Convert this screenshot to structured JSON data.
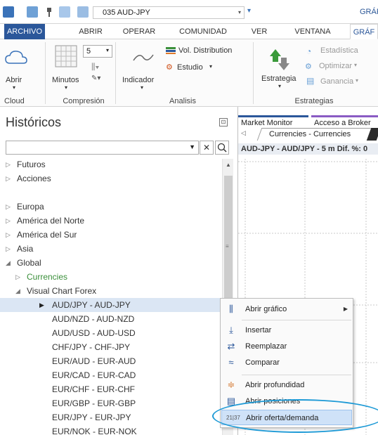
{
  "titlebar": {
    "document": "035 AUD-JPY",
    "right_tab": "GRÁF"
  },
  "tabs": [
    "ARCHIVO",
    "ABRIR",
    "OPERAR",
    "COMUNIDAD",
    "VER",
    "VENTANA",
    "GRÁF"
  ],
  "ribbon": {
    "abrir": "Abrir",
    "minutos": "Minutos",
    "compression_value": "5",
    "indicador": "Indicador",
    "vol_distribution": "Vol. Distribution",
    "estudio": "Estudio",
    "estrategia": "Estrategia",
    "estadistica": "Estadística",
    "optimizar": "Optimizar",
    "ganancia": "Ganancia",
    "groups": [
      "Cloud",
      "Compresión",
      "Analisis",
      "Estrategias"
    ]
  },
  "left_panel": {
    "title": "Históricos",
    "search_value": "",
    "tree": [
      {
        "label": "Futuros",
        "level": 0,
        "toggle": "▷"
      },
      {
        "label": "Acciones",
        "level": 0,
        "toggle": "▷"
      },
      {
        "label": "Europa",
        "level": 0,
        "toggle": "▷"
      },
      {
        "label": "América del Norte",
        "level": 0,
        "toggle": "▷"
      },
      {
        "label": "América del Sur",
        "level": 0,
        "toggle": "▷"
      },
      {
        "label": "Asia",
        "level": 0,
        "toggle": "▷"
      },
      {
        "label": "Global",
        "level": 0,
        "toggle": "◢"
      },
      {
        "label": "Currencies",
        "level": 1,
        "toggle": "▷",
        "color": "#3a8f3a"
      },
      {
        "label": "Visual Chart Forex",
        "level": 1,
        "toggle": "◢"
      },
      {
        "label": "AUD/JPY - AUD-JPY",
        "level": 2,
        "toggle": "▶",
        "selected": true
      },
      {
        "label": "AUD/NZD - AUD-NZD",
        "level": 2
      },
      {
        "label": "AUD/USD - AUD-USD",
        "level": 2
      },
      {
        "label": "CHF/JPY - CHF-JPY",
        "level": 2
      },
      {
        "label": "EUR/AUD - EUR-AUD",
        "level": 2
      },
      {
        "label": "EUR/CAD - EUR-CAD",
        "level": 2
      },
      {
        "label": "EUR/CHF - EUR-CHF",
        "level": 2
      },
      {
        "label": "EUR/GBP - EUR-GBP",
        "level": 2
      },
      {
        "label": "EUR/JPY - EUR-JPY",
        "level": 2
      },
      {
        "label": "EUR/NOK - EUR-NOK",
        "level": 2
      }
    ]
  },
  "right_panel": {
    "tab_market_monitor": "Market Monitor",
    "tab_acceso": "Acceso a Broker",
    "subtab": "Currencies - Currencies",
    "chart_header": "AUD-JPY - AUD/JPY - 5 m  Dif. %: 0"
  },
  "context_menu": {
    "items": [
      {
        "label": "Abrir gráfico",
        "icon": "chart-bars-icon",
        "submenu": true
      },
      {
        "label": "Insertar",
        "icon": "insert-icon"
      },
      {
        "label": "Reemplazar",
        "icon": "replace-icon"
      },
      {
        "label": "Comparar",
        "icon": "compare-icon"
      },
      {
        "label": "Abrir profundidad",
        "icon": "depth-icon"
      },
      {
        "label": "Abrir posiciones",
        "icon": "positions-icon"
      },
      {
        "label": "Abrir oferta/demanda",
        "icon": "bid-ask-icon",
        "highlighted": true
      }
    ]
  },
  "colors": {
    "accent": "#2b579a",
    "highlight": "#cfe2f8",
    "callout": "#1e9ad6",
    "currencies_green": "#3a8f3a"
  }
}
